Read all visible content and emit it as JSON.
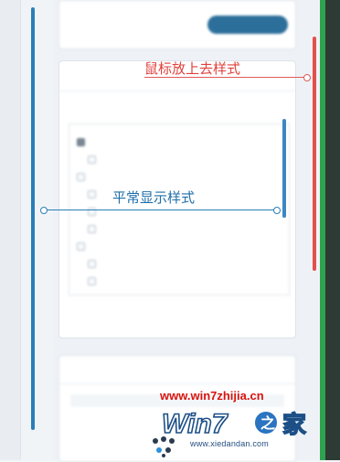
{
  "annotations": {
    "hover_style_label": "鼠标放上去样式",
    "normal_style_label": "平常显示样式"
  },
  "colors": {
    "hover_annotation": "#e0403b",
    "normal_annotation": "#2b7fb8",
    "green_strip": "#2fa24f",
    "scroll_thumb": "#3d86c4"
  },
  "watermark": {
    "url": "www.win7zhijia.cn",
    "logo_text": "Win7之家",
    "sub_url": "www.xiedandan.com"
  },
  "panel": {
    "top_card": {
      "warn_text": "",
      "button_label": ""
    },
    "main_card": {
      "title": "",
      "sub_label": "",
      "sub_link": "",
      "footer_link": ""
    },
    "tree_rows": [
      {
        "text": "",
        "checked": true
      },
      {
        "text": "",
        "checked": false
      },
      {
        "text": "",
        "checked": false
      },
      {
        "text": "",
        "checked": false
      },
      {
        "text": "",
        "checked": false
      },
      {
        "text": "",
        "checked": false
      },
      {
        "text": "",
        "checked": false
      },
      {
        "text": "",
        "checked": false
      },
      {
        "text": "",
        "checked": false
      }
    ],
    "bottom_card": {
      "title": ""
    }
  }
}
